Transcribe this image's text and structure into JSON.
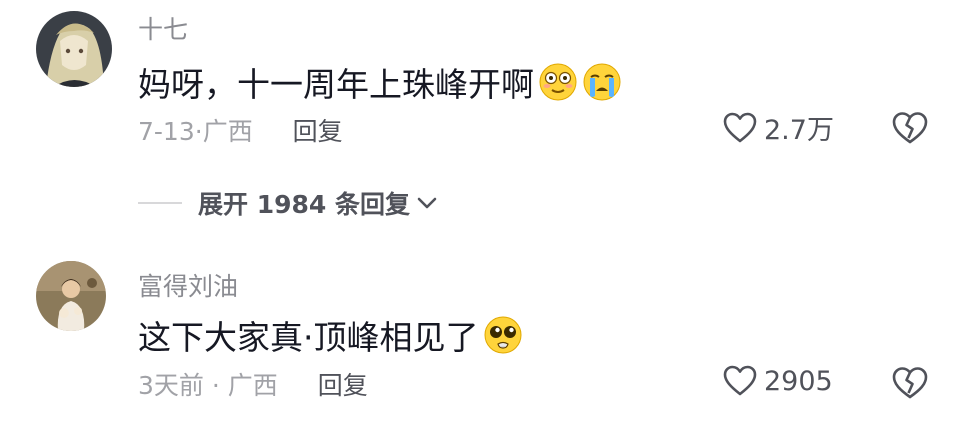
{
  "comments": [
    {
      "username": "十七",
      "text": "妈呀，十一周年上珠峰开啊",
      "emojis": [
        "flushed-face-emoji",
        "crying-face-emoji"
      ],
      "date": "7-13",
      "location": "广西",
      "reply_label": "回复",
      "likes": "2.7万"
    },
    {
      "username": "富得刘油",
      "text": "这下大家真·顶峰相见了",
      "emojis": [
        "pleading-face-emoji"
      ],
      "date": "3天前",
      "location": "广西",
      "reply_label": "回复",
      "likes": "2905"
    }
  ],
  "expand_replies": {
    "label": "展开 1984 条回复"
  },
  "colors": {
    "username": "#8a8b91",
    "meta": "#a1a2a7",
    "text": "#161823",
    "action": "#50525a"
  }
}
